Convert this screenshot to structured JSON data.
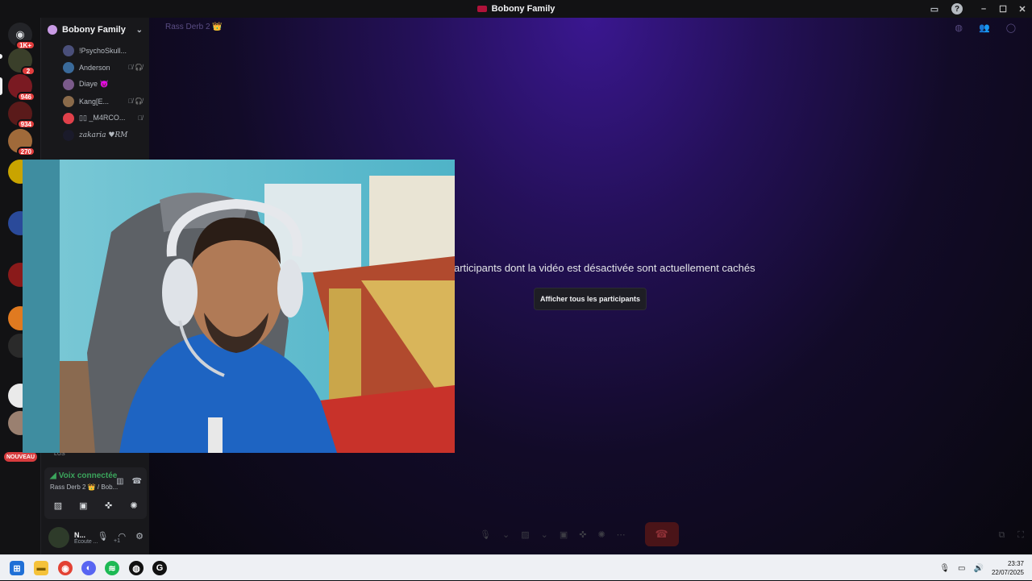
{
  "window": {
    "title": "Bobony Family",
    "help_label": "?",
    "minimize_label": "–",
    "maximize_label": "☐",
    "close_label": "✕"
  },
  "rail": {
    "servers": [
      {
        "badge": "1K+"
      },
      {
        "badge": "2"
      },
      {
        "badge": "946"
      },
      {
        "badge": "934"
      },
      {
        "badge": "270"
      }
    ],
    "new_label": "NOUVEAU"
  },
  "guild": {
    "name": "Bobony Family",
    "members": [
      {
        "name": "!PsychoSkull...",
        "status": ""
      },
      {
        "name": "Anderson",
        "status": "🎙̸ 🎧̸"
      },
      {
        "name": "Diaye 😈",
        "status": ""
      },
      {
        "name": "Kang[E...",
        "status": "🎙̸ 🎧̸"
      },
      {
        "name": "▯▯ _M4RCO...",
        "status": "🎙̸"
      },
      {
        "name": "zakaria ♥RM",
        "status": ""
      }
    ],
    "lus_label": "LUS"
  },
  "voice": {
    "status": "Voix connectée",
    "channel": "Rass Derb 2 👑 / Bob..."
  },
  "user": {
    "name": "N...",
    "status": "Écoute ...",
    "extra": "+1"
  },
  "main": {
    "channel_header": "Rass Derb 2 👑",
    "hidden_message": "articipants dont la vidéo est désactivée sont actuellement cachés",
    "show_all_button": "Afficher tous les participants"
  },
  "taskbar": {
    "time": "23:37",
    "date": "22/07/2025"
  },
  "colors": {
    "accent_purple": "#3a1790",
    "voice_green": "#3ba55c",
    "badge_red": "#e23d3d"
  }
}
